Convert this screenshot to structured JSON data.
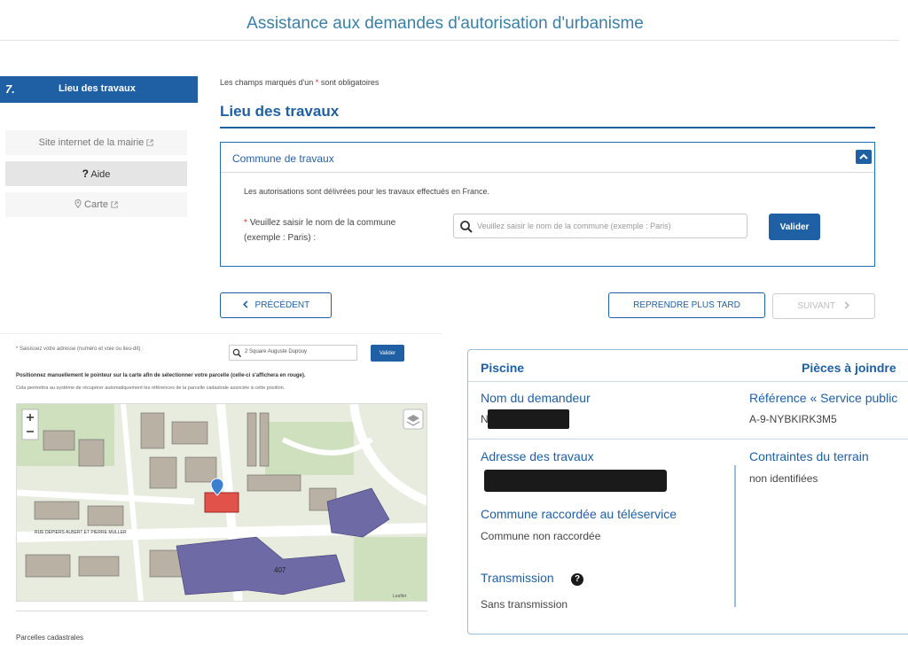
{
  "app": {
    "title": "Assistance aux demandes d'autorisation d'urbanisme"
  },
  "sidebar": {
    "step_number": "7.",
    "step_label": "Lieu des travaux",
    "mairie_link": "Site internet de la mairie",
    "aide": "Aide",
    "carte": "Carte"
  },
  "form": {
    "required_note_prefix": "Les champs marqués d'un",
    "required_star": "*",
    "required_note_suffix": "sont obligatoires",
    "section_title": "Lieu des travaux",
    "fieldset_title": "Commune de travaux",
    "info_text": "Les autorisations sont délivrées pour les travaux effectués en France.",
    "commune_label": "Veuillez saisir le nom de la commune (exemple : Paris) :",
    "commune_placeholder": "Veuillez saisir le nom de la commune (exemple : Paris)",
    "valider_label": "Valider"
  },
  "nav": {
    "previous": "PRÉCÉDENT",
    "later": "REPRENDRE PLUS TARD",
    "next": "SUIVANT"
  },
  "map_panel": {
    "address_label": "* Saisissez votre adresse (numéro et voie ou lieu-dit) :",
    "search_value": "2 Square Auguste Dupouy",
    "valider_label": "Valider",
    "instruction": "Positionnez manuellement le pointeur sur la carte afin de sélectionner votre parcelle (celle-ci s'affichera en rouge).",
    "explanation": "Cela permettra au système de récupérer automatiquement les références de la parcelle cadastrale associée à cette position.",
    "street_label": "RUE DEPIERS ALBERT ET PIERRE MULLER",
    "parcel_number": "407",
    "leaflet_attrib": "Leaflet",
    "parcelles_label": "Parcelles cadastrales"
  },
  "summary": {
    "title": "Piscine",
    "pieces": "Pièces à joindre",
    "nom_label": "Nom du demandeur",
    "nom_initial": "N",
    "reference_label": "Référence « Service public",
    "reference_value": "A-9-NYBKIRK3M5",
    "adresse_label": "Adresse des travaux",
    "commune_rac_label": "Commune raccordée au téléservice",
    "commune_rac_value": "Commune non raccordée",
    "transmission_label": "Transmission",
    "transmission_value": "Sans transmission",
    "contraintes_label": "Contraintes du terrain",
    "contraintes_value": "non identifiées"
  },
  "colors": {
    "primary": "#1f5fa3",
    "title_blue": "#3a80a6",
    "required_red": "#d13030",
    "selected_parcel": "#e0524a",
    "building_purple": "#6d6aa6"
  },
  "icons": [
    "external-link-icon",
    "question-icon",
    "map-pin-icon",
    "search-icon",
    "chevron-up-icon",
    "chevron-left-icon",
    "chevron-right-icon",
    "help-circle-icon",
    "layers-icon",
    "zoom-in-icon",
    "zoom-out-icon",
    "location-marker-icon"
  ]
}
